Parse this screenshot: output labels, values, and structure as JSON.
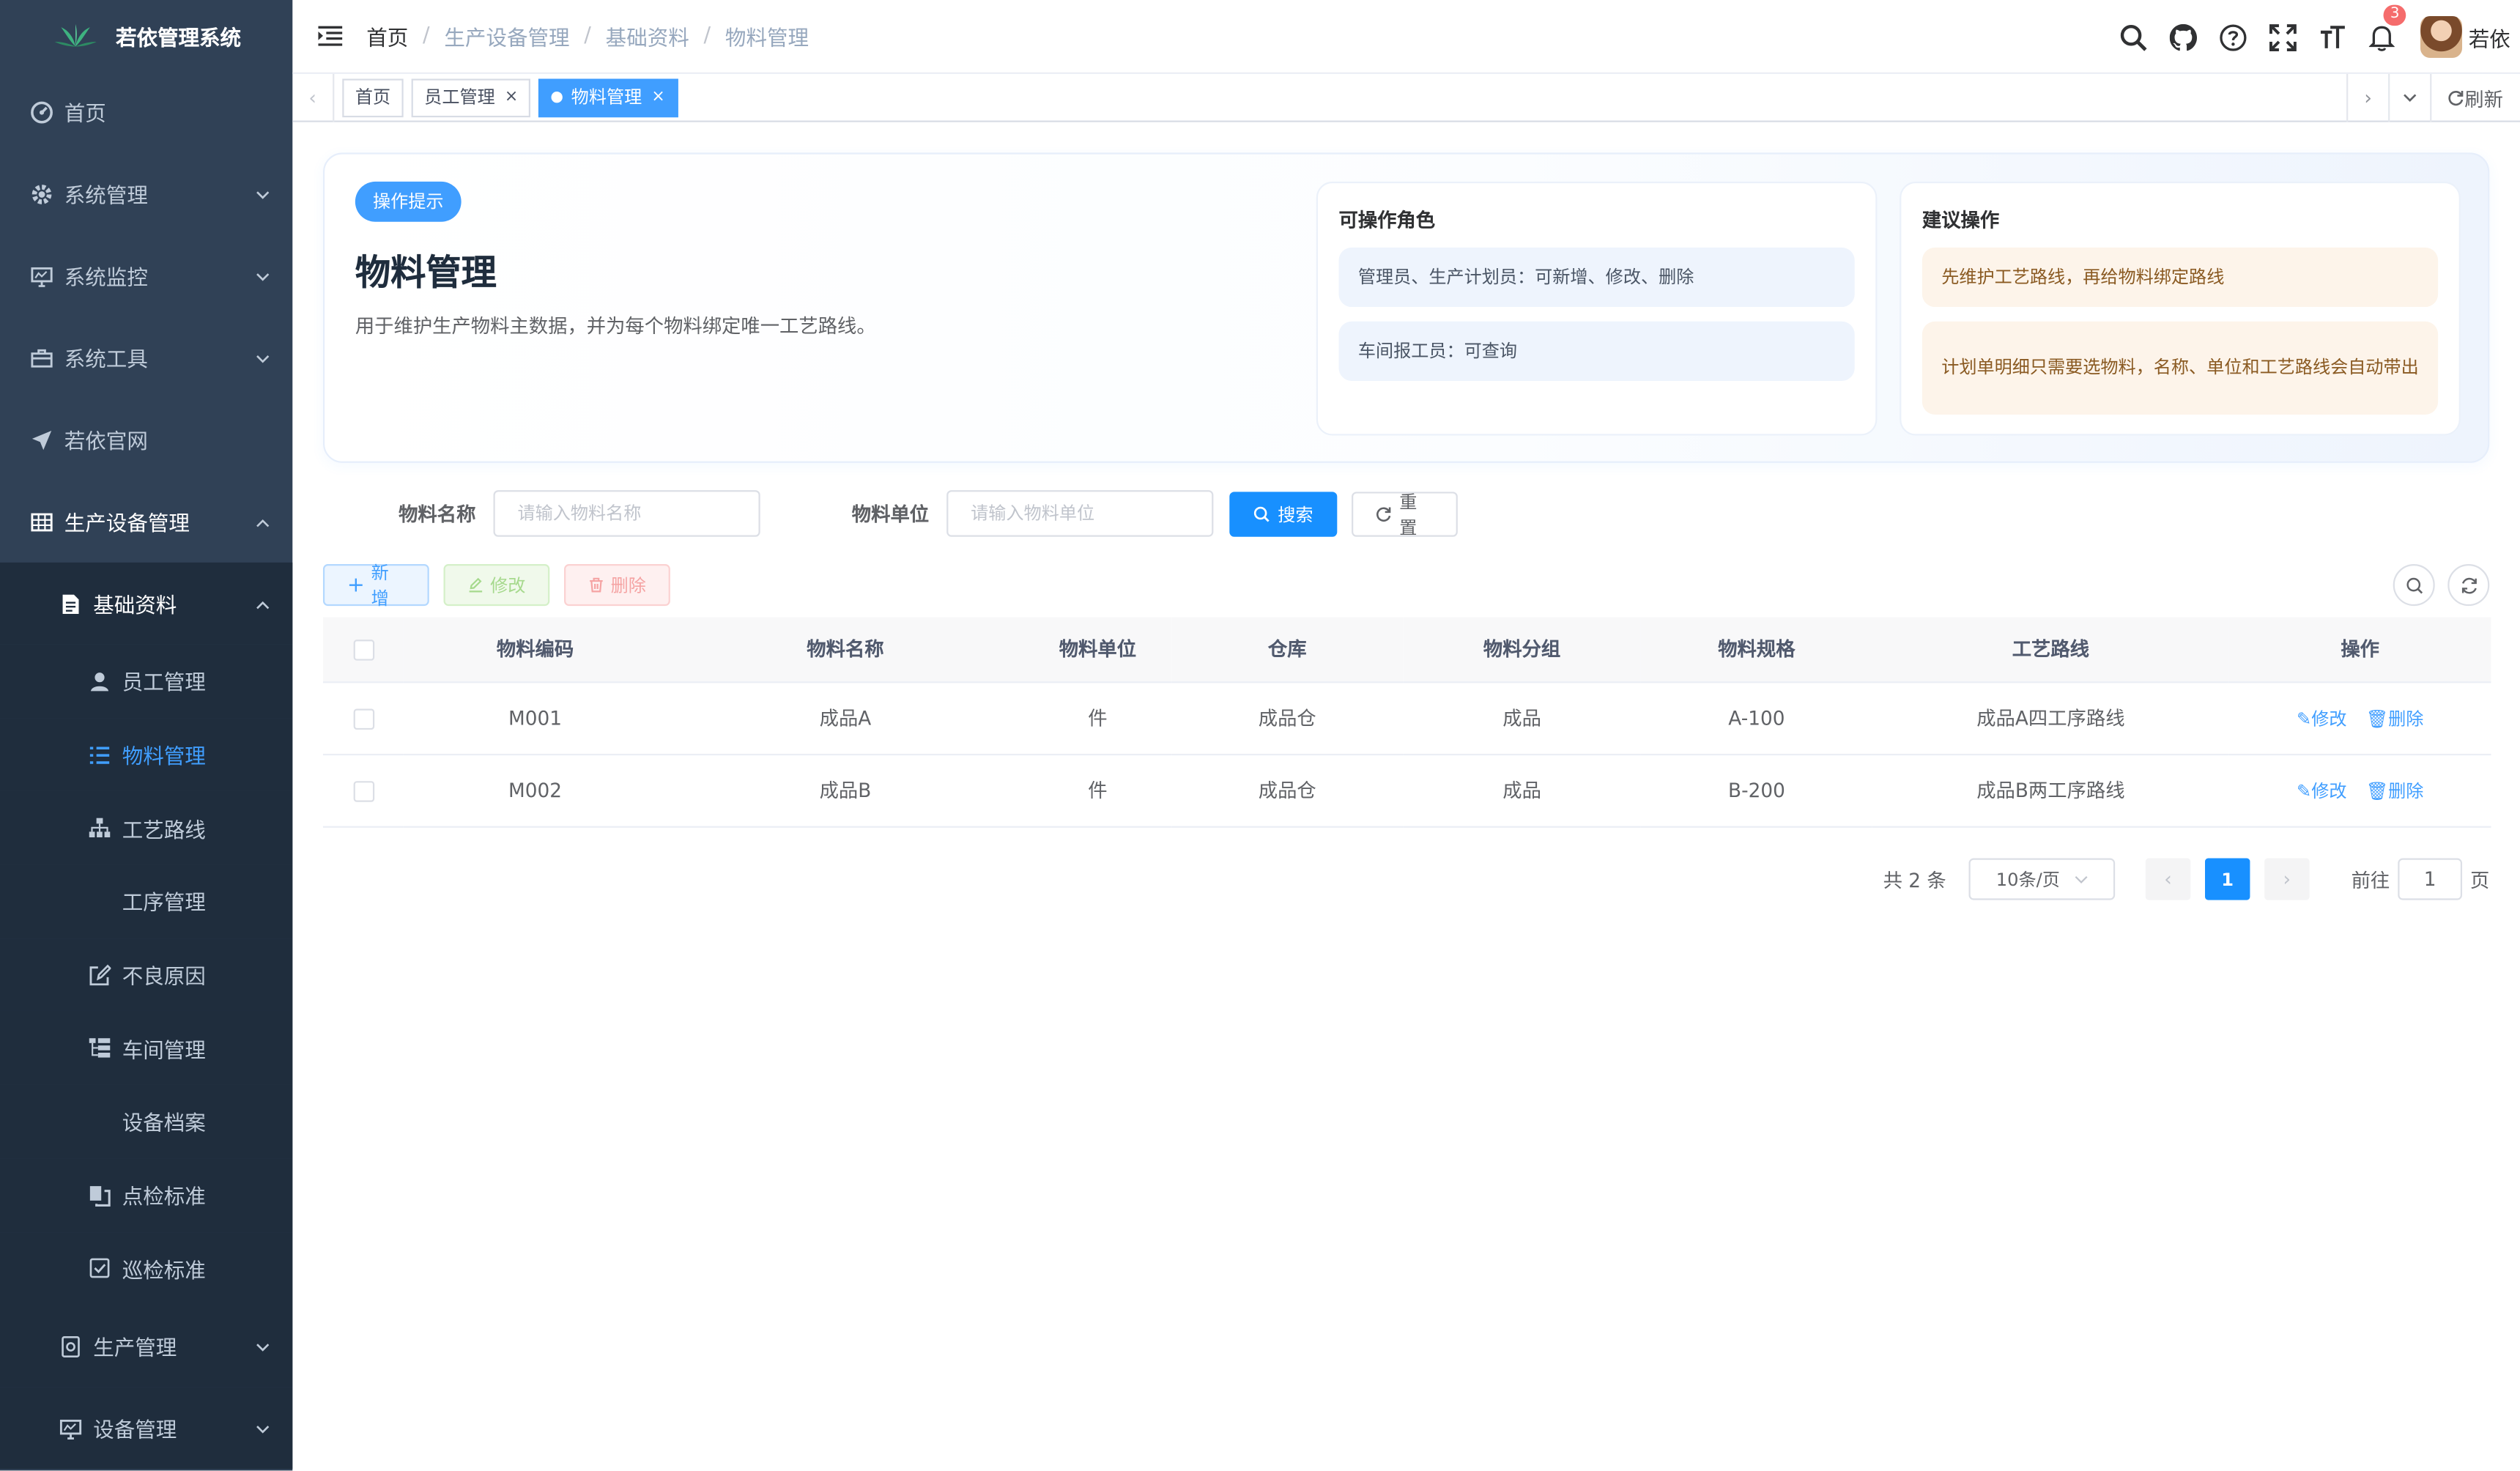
{
  "app": {
    "title": "若依管理系统"
  },
  "sidebar": {
    "items": [
      {
        "label": "首页",
        "icon": "dashboard-icon"
      },
      {
        "label": "系统管理",
        "icon": "gear-icon"
      },
      {
        "label": "系统监控",
        "icon": "monitor-icon"
      },
      {
        "label": "系统工具",
        "icon": "toolbox-icon"
      },
      {
        "label": "若依官网",
        "icon": "send-icon"
      },
      {
        "label": "生产设备管理",
        "icon": "table-icon"
      }
    ],
    "group": {
      "label": "基础资料",
      "icon": "document-icon"
    },
    "sub_items": [
      {
        "label": "员工管理",
        "icon": "user-icon"
      },
      {
        "label": "物料管理",
        "icon": "list-icon"
      },
      {
        "label": "工艺路线",
        "icon": "tree-icon"
      },
      {
        "label": "工序管理",
        "icon": ""
      },
      {
        "label": "不良原因",
        "icon": "edit-icon"
      },
      {
        "label": "车间管理",
        "icon": "tree-table-icon"
      },
      {
        "label": "设备档案",
        "icon": ""
      },
      {
        "label": "点检标准",
        "icon": "copy-icon"
      },
      {
        "label": "巡检标准",
        "icon": "checkbox-icon"
      }
    ],
    "bottom": [
      {
        "label": "生产管理",
        "icon": "build-icon"
      },
      {
        "label": "设备管理",
        "icon": "monitor-icon"
      }
    ]
  },
  "navbar": {
    "breadcrumb": [
      "首页",
      "生产设备管理",
      "基础资料",
      "物料管理"
    ],
    "notification_count": "3",
    "user_name": "若依"
  },
  "tags": {
    "items": [
      "首页",
      "员工管理",
      "物料管理"
    ],
    "close_glyph": "×",
    "refresh_label": "刷新"
  },
  "tips": {
    "pill": "操作提示",
    "title": "物料管理",
    "desc": "用于维护生产物料主数据，并为每个物料绑定唯一工艺路线。",
    "roles_title": "可操作角色",
    "roles": [
      "管理员、生产计划员：可新增、修改、删除",
      "车间报工员：可查询"
    ],
    "advice_title": "建议操作",
    "advice": [
      "先维护工艺路线，再给物料绑定路线",
      "计划单明细只需要选物料，名称、单位和工艺路线会自动带出"
    ]
  },
  "search": {
    "name_label": "物料名称",
    "name_placeholder": "请输入物料名称",
    "unit_label": "物料单位",
    "unit_placeholder": "请输入物料单位",
    "search_btn": "搜索",
    "reset_btn": "重置"
  },
  "toolbar": {
    "add": "新增",
    "edit": "修改",
    "delete": "删除"
  },
  "table": {
    "columns": [
      "物料编码",
      "物料名称",
      "物料单位",
      "仓库",
      "物料分组",
      "物料规格",
      "工艺路线",
      "操作"
    ],
    "rows": [
      {
        "code": "M001",
        "name": "成品A",
        "unit": "件",
        "warehouse": "成品仓",
        "group": "成品",
        "spec": "A-100",
        "route": "成品A四工序路线"
      },
      {
        "code": "M002",
        "name": "成品B",
        "unit": "件",
        "warehouse": "成品仓",
        "group": "成品",
        "spec": "B-200",
        "route": "成品B两工序路线"
      }
    ],
    "edit_label": "修改",
    "delete_label": "删除"
  },
  "pagination": {
    "total": "共 2 条",
    "page_size": "10条/页",
    "current": "1",
    "goto_label": "前往",
    "goto_value": "1",
    "page_suffix": "页"
  },
  "colors": {
    "sidebar_bg": "#304156",
    "submenu_bg": "#1f2d3d",
    "primary": "#409eff",
    "active_tag": "#409eff"
  }
}
